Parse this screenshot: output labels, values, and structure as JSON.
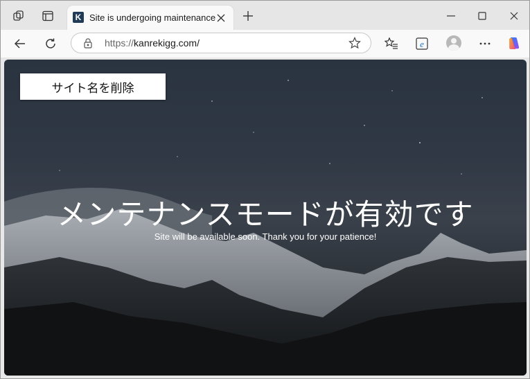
{
  "browser": {
    "tab": {
      "favicon_letter": "K",
      "title": "Site is undergoing maintenance"
    },
    "url": {
      "protocol": "https://",
      "host": "kanrekigg.com/"
    }
  },
  "page": {
    "button_label": "サイト名を削除",
    "headline": "メンテナンスモードが有効です",
    "subtext": "Site will be available soon. Thank you for your patience!"
  },
  "icons": {
    "left": [
      "workspaces-icon",
      "tab-actions-icon"
    ],
    "toolbar": [
      "back-icon",
      "refresh-icon",
      "lock-icon",
      "favorite-star-icon",
      "favorites-icon",
      "ie-mode-icon",
      "profile-icon",
      "more-icon",
      "copilot-icon"
    ]
  },
  "colors": {
    "favicon_bg": "#1f3b57",
    "tab_bg": "#f9f9f9",
    "chrome_bg": "#e6e6e6"
  }
}
